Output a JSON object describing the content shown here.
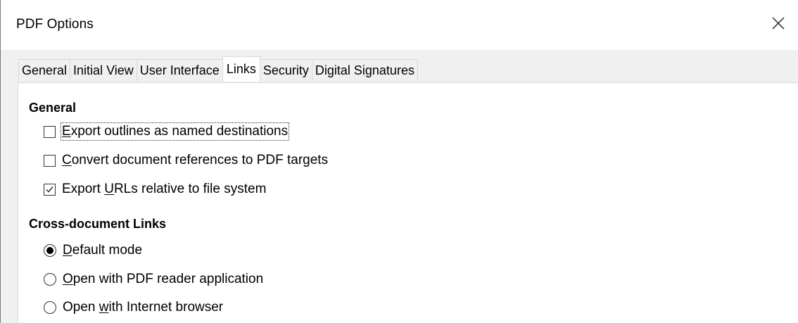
{
  "window": {
    "title": "PDF Options",
    "close_icon": "close-icon"
  },
  "tabs": [
    {
      "label": "General",
      "active": false
    },
    {
      "label": "Initial View",
      "active": false
    },
    {
      "label": "User Interface",
      "active": false
    },
    {
      "label": "Links",
      "active": true
    },
    {
      "label": "Security",
      "active": false
    },
    {
      "label": "Digital Signatures",
      "active": false
    }
  ],
  "general_section": {
    "heading": "General",
    "options": [
      {
        "mnemonic": "E",
        "label_rest": "xport outlines as named destinations",
        "checked": false,
        "focused": true
      },
      {
        "mnemonic": "C",
        "label_rest": "onvert document references to PDF targets",
        "checked": false,
        "focused": false
      },
      {
        "label_before": "Export ",
        "mnemonic": "U",
        "label_rest": "RLs relative to file system",
        "checked": true,
        "focused": false
      }
    ]
  },
  "cross_doc_section": {
    "heading": "Cross-document Links",
    "options": [
      {
        "mnemonic": "D",
        "label_rest": "efault mode",
        "selected": true
      },
      {
        "mnemonic": "O",
        "label_rest": "pen with PDF reader application",
        "selected": false
      },
      {
        "label_before": "Open ",
        "mnemonic": "w",
        "label_rest": "ith Internet browser",
        "selected": false
      }
    ]
  }
}
